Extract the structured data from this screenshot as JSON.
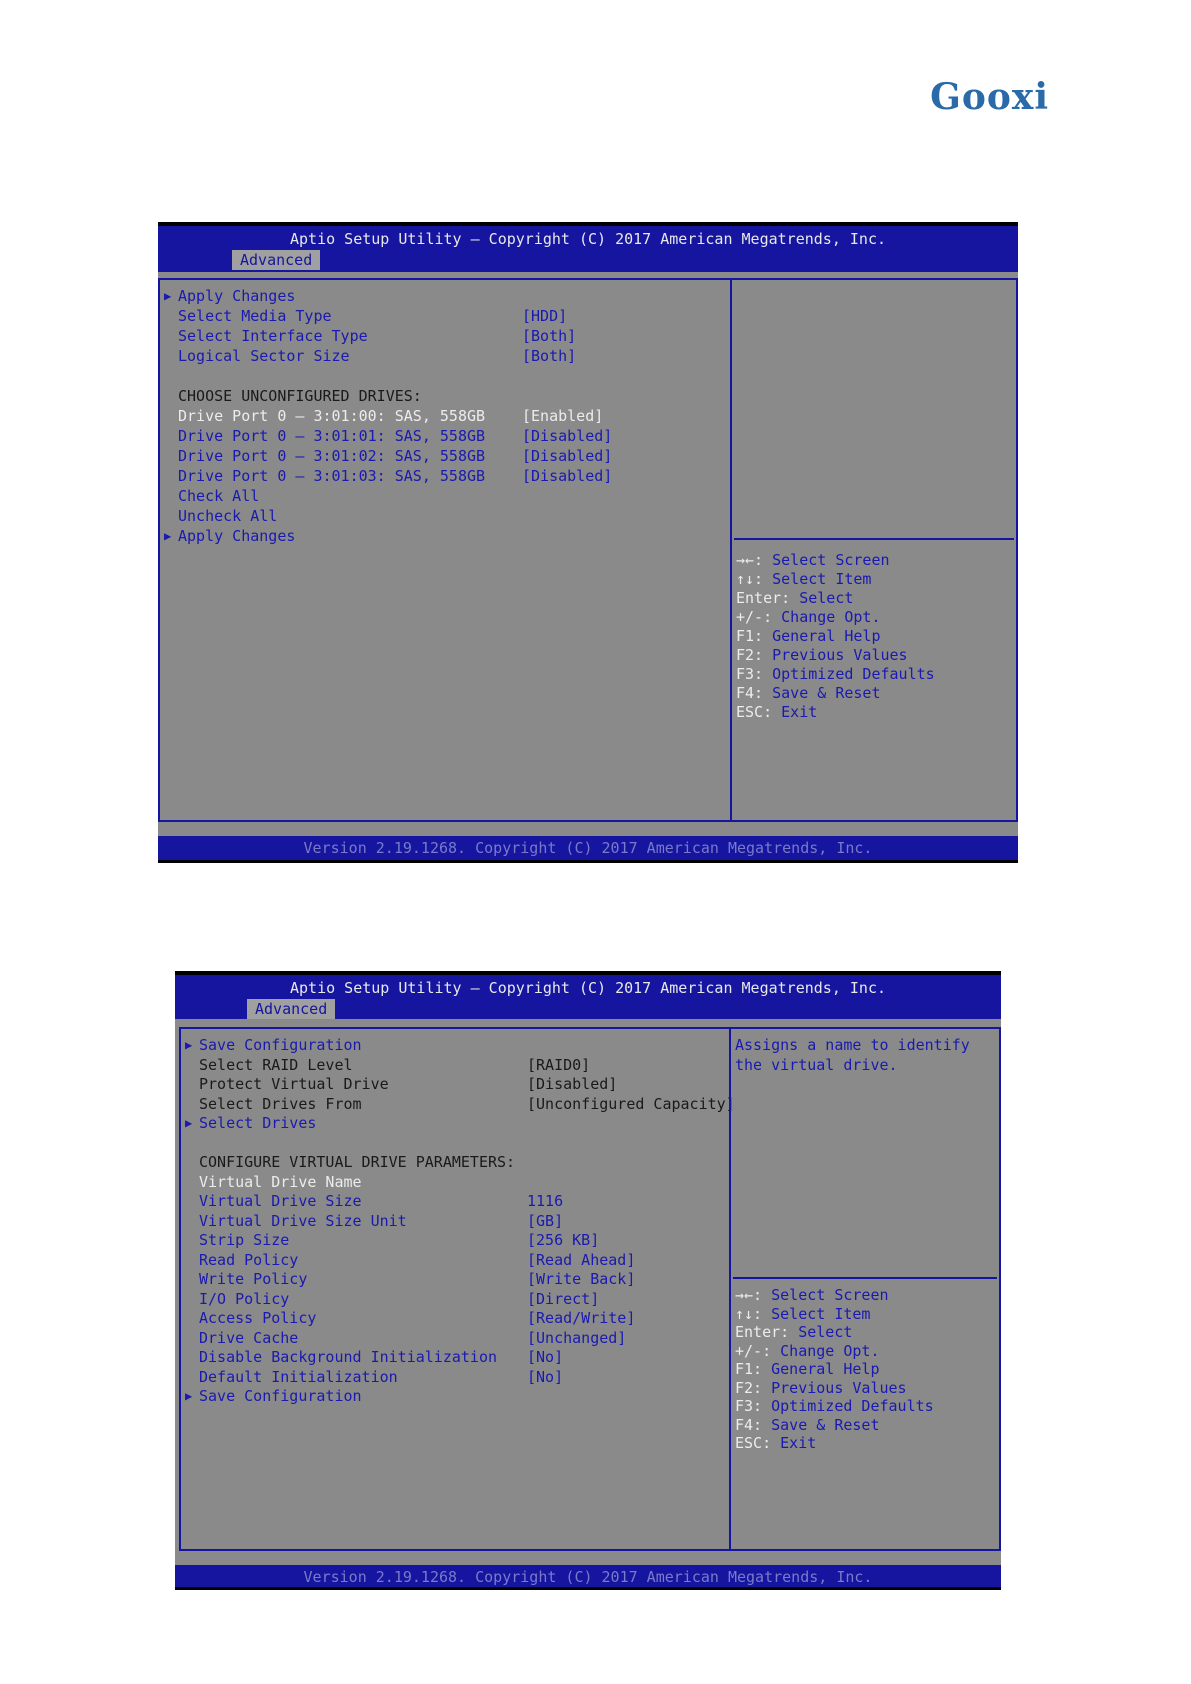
{
  "brand": {
    "logo_text": "Gooxi"
  },
  "screen1": {
    "title": "Aptio Setup Utility – Copyright (C) 2017 American Megatrends, Inc.",
    "tab": "Advanced",
    "rows": [
      {
        "label": "Apply Changes",
        "value": "",
        "submenu": true,
        "color": "blue"
      },
      {
        "label": "Select Media Type",
        "value": "[HDD]",
        "submenu": false,
        "color": "blue"
      },
      {
        "label": "Select Interface Type",
        "value": "[Both]",
        "submenu": false,
        "color": "blue"
      },
      {
        "label": "Logical Sector Size",
        "value": "[Both]",
        "submenu": false,
        "color": "blue"
      },
      {
        "label": "",
        "value": "",
        "submenu": false,
        "color": "blue"
      },
      {
        "label": "CHOOSE UNCONFIGURED DRIVES:",
        "value": "",
        "submenu": false,
        "color": "black"
      },
      {
        "label": "Drive Port 0 – 3:01:00: SAS, 558GB",
        "value": "[Enabled]",
        "submenu": false,
        "color": "white"
      },
      {
        "label": "Drive Port 0 – 3:01:01: SAS, 558GB",
        "value": "[Disabled]",
        "submenu": false,
        "color": "blue"
      },
      {
        "label": "Drive Port 0 – 3:01:02: SAS, 558GB",
        "value": "[Disabled]",
        "submenu": false,
        "color": "blue"
      },
      {
        "label": "Drive Port 0 – 3:01:03: SAS, 558GB",
        "value": "[Disabled]",
        "submenu": false,
        "color": "blue"
      },
      {
        "label": "Check All",
        "value": "",
        "submenu": false,
        "color": "blue"
      },
      {
        "label": "Uncheck All",
        "value": "",
        "submenu": false,
        "color": "blue"
      },
      {
        "label": "Apply Changes",
        "value": "",
        "submenu": true,
        "color": "blue"
      }
    ],
    "description": "",
    "help": [
      {
        "key": "→←:",
        "text": " Select Screen"
      },
      {
        "key": "↑↓:",
        "text": " Select Item"
      },
      {
        "key": "Enter:",
        "text": " Select"
      },
      {
        "key": "+/-:",
        "text": " Change Opt."
      },
      {
        "key": "F1:",
        "text": " General Help"
      },
      {
        "key": "F2:",
        "text": " Previous Values"
      },
      {
        "key": "F3:",
        "text": " Optimized Defaults"
      },
      {
        "key": "F4:",
        "text": " Save & Reset"
      },
      {
        "key": "ESC:",
        "text": " Exit"
      }
    ],
    "footer": "Version 2.19.1268. Copyright (C) 2017 American Megatrends, Inc."
  },
  "screen2": {
    "title": "Aptio Setup Utility – Copyright (C) 2017 American Megatrends, Inc.",
    "tab": "Advanced",
    "rows": [
      {
        "label": "Save Configuration",
        "value": "",
        "submenu": true,
        "color": "blue"
      },
      {
        "label": "Select RAID Level",
        "value": "[RAID0]",
        "submenu": false,
        "color": "black"
      },
      {
        "label": "Protect Virtual Drive",
        "value": "[Disabled]",
        "submenu": false,
        "color": "black"
      },
      {
        "label": "Select Drives From",
        "value": "[Unconfigured Capacity]",
        "submenu": false,
        "color": "black"
      },
      {
        "label": "Select Drives",
        "value": "",
        "submenu": true,
        "color": "blue"
      },
      {
        "label": "",
        "value": "",
        "submenu": false,
        "color": "blue"
      },
      {
        "label": "CONFIGURE VIRTUAL DRIVE PARAMETERS:",
        "value": "",
        "submenu": false,
        "color": "black"
      },
      {
        "label": "Virtual Drive Name",
        "value": "",
        "submenu": false,
        "color": "white"
      },
      {
        "label": "Virtual Drive Size",
        "value": "1116",
        "submenu": false,
        "color": "blue"
      },
      {
        "label": "Virtual Drive Size Unit",
        "value": "[GB]",
        "submenu": false,
        "color": "blue"
      },
      {
        "label": "Strip Size",
        "value": "[256 KB]",
        "submenu": false,
        "color": "blue"
      },
      {
        "label": "Read Policy",
        "value": "[Read Ahead]",
        "submenu": false,
        "color": "blue"
      },
      {
        "label": "Write Policy",
        "value": "[Write Back]",
        "submenu": false,
        "color": "blue"
      },
      {
        "label": "I/O Policy",
        "value": "[Direct]",
        "submenu": false,
        "color": "blue"
      },
      {
        "label": "Access Policy",
        "value": "[Read/Write]",
        "submenu": false,
        "color": "blue"
      },
      {
        "label": "Drive Cache",
        "value": "[Unchanged]",
        "submenu": false,
        "color": "blue"
      },
      {
        "label": "Disable Background Initialization",
        "value": "[No]",
        "submenu": false,
        "color": "blue"
      },
      {
        "label": "Default Initialization",
        "value": "[No]",
        "submenu": false,
        "color": "blue"
      },
      {
        "label": "Save Configuration",
        "value": "",
        "submenu": true,
        "color": "blue"
      }
    ],
    "description": "Assigns a name to identify the virtual drive.",
    "help": [
      {
        "key": "→←:",
        "text": " Select Screen"
      },
      {
        "key": "↑↓:",
        "text": " Select Item"
      },
      {
        "key": "Enter:",
        "text": " Select"
      },
      {
        "key": "+/-:",
        "text": " Change Opt."
      },
      {
        "key": "F1:",
        "text": " General Help"
      },
      {
        "key": "F2:",
        "text": " Previous Values"
      },
      {
        "key": "F3:",
        "text": " Optimized Defaults"
      },
      {
        "key": "F4:",
        "text": " Save & Reset"
      },
      {
        "key": "ESC:",
        "text": " Exit"
      }
    ],
    "footer": "Version 2.19.1268. Copyright (C) 2017 American Megatrends, Inc."
  }
}
